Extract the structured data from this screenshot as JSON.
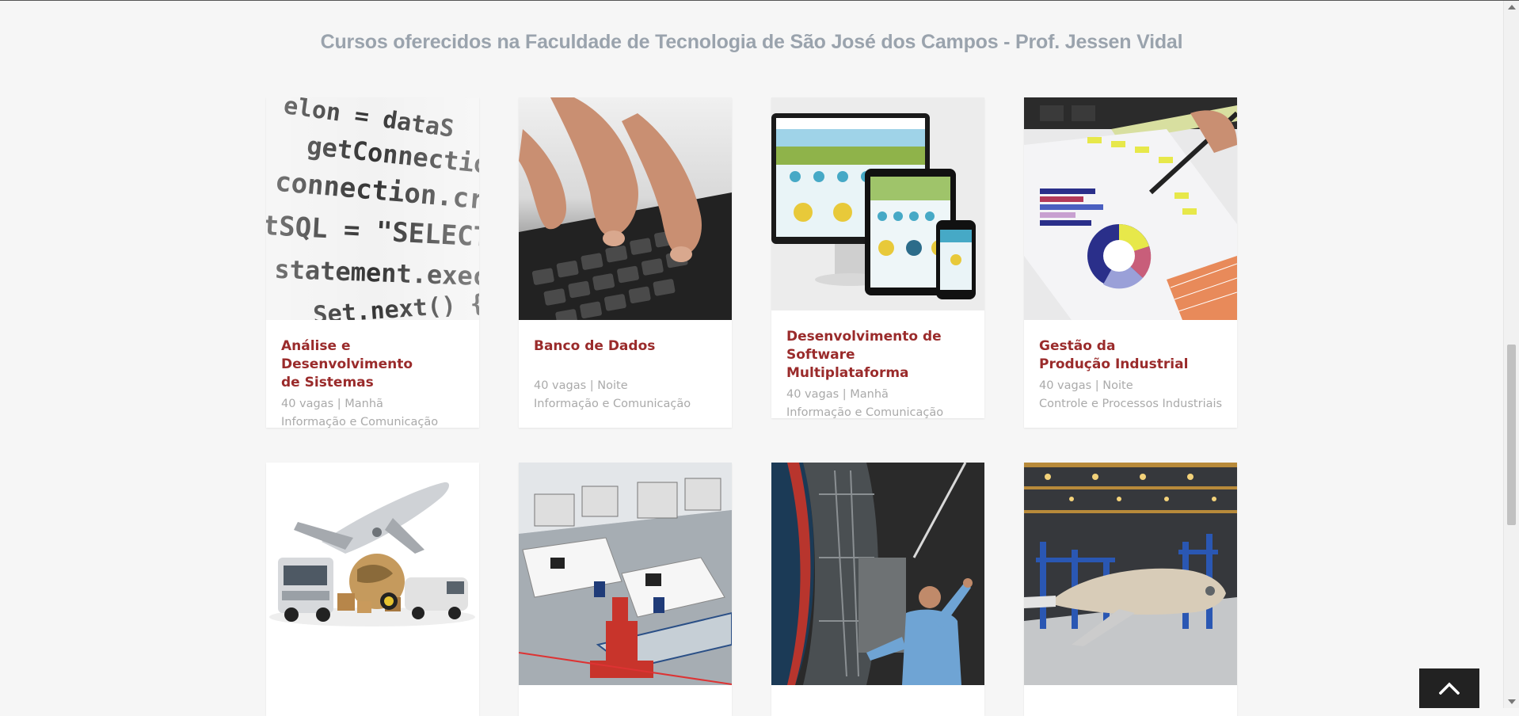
{
  "page": {
    "title": "Cursos oferecidos na Faculdade de Tecnologia de São José dos Campos - Prof. Jessen Vidal"
  },
  "courses": [
    {
      "title_line1": "Análise e Desenvolvimento",
      "title_line2": "de Sistemas",
      "vacancies": "40 vagas | Manhã",
      "area": "Informação e Comunicação",
      "image": "code-screen-image"
    },
    {
      "title_line1": "Banco de Dados",
      "title_line2": "",
      "vacancies": "40 vagas | Noite",
      "area": "Informação e Comunicação",
      "image": "keyboard-hands-image"
    },
    {
      "title_line1": "Desenvolvimento de",
      "title_line2": "Software Multiplataforma",
      "vacancies": "40 vagas | Manhã",
      "area": "Informação e Comunicação",
      "image": "multi-device-image"
    },
    {
      "title_line1": "Gestão da",
      "title_line2": "Produção Industrial",
      "vacancies": "40 vagas | Noite",
      "area": "Controle e Processos Industriais",
      "image": "charts-analysis-image"
    },
    {
      "image": "logistics-image"
    },
    {
      "image": "industrial-lab-image"
    },
    {
      "image": "aircraft-engine-image"
    },
    {
      "image": "aircraft-assembly-image"
    }
  ],
  "colors": {
    "title": "#9aa3ad",
    "course_title": "#9a2b2b",
    "meta": "#aaaaaa",
    "background": "#f6f6f6"
  },
  "controls": {
    "back_to_top_icon": "chevron-up-icon"
  }
}
